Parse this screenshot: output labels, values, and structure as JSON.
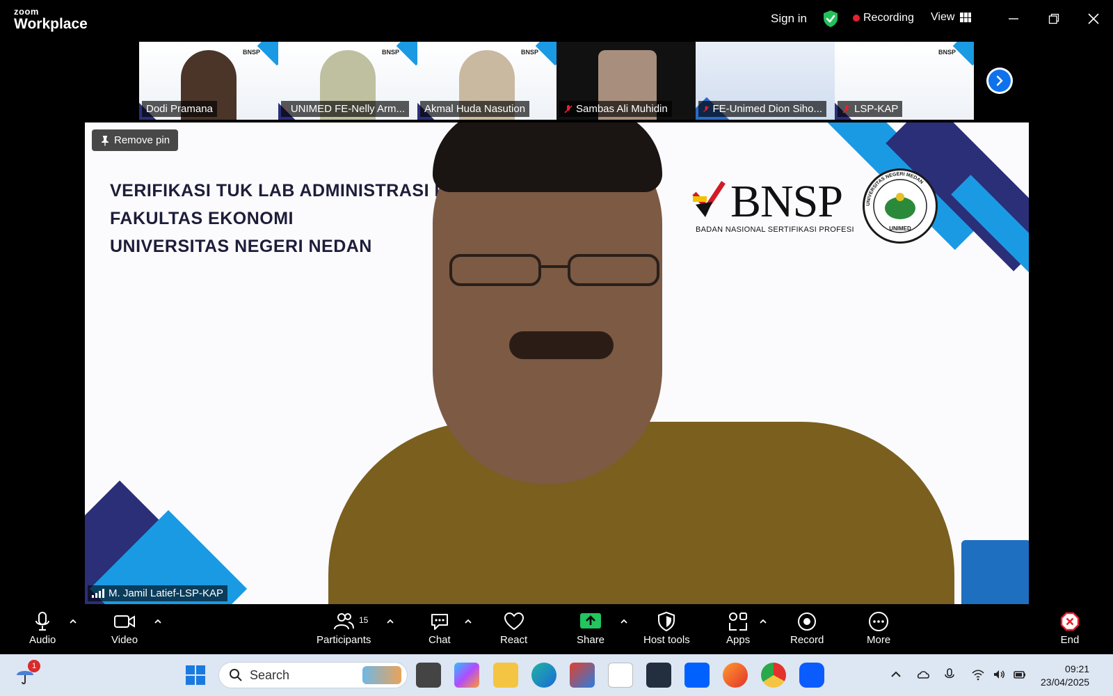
{
  "app": {
    "brand_small": "zoom",
    "brand_big": "Workplace"
  },
  "titlebar": {
    "sign_in": "Sign in",
    "recording": "Recording",
    "view": "View"
  },
  "participants_strip": [
    {
      "name": "Dodi Pramana",
      "muted": false
    },
    {
      "name": "UNIMED FE-Nelly Arm...",
      "muted": true
    },
    {
      "name": "Akmal Huda Nasution",
      "muted": false
    },
    {
      "name": "Sambas Ali Muhidin",
      "muted": true
    },
    {
      "name": "FE-Unimed Dion Siho...",
      "muted": true
    },
    {
      "name": "LSP-KAP",
      "muted": true
    }
  ],
  "main_video": {
    "remove_pin": "Remove pin",
    "slide_title_lines": [
      "VERIFIKASI TUK LAB ADMINISTRASI PE",
      "FAKULTAS EKONOMI",
      "UNIVERSITAS NEGERI NEDAN"
    ],
    "bnsp_word": "BNSP",
    "bnsp_sub": "BADAN NASIONAL SERTIFIKASI PROFESI",
    "unimed_ring": "UNIVERSITAS NEGERI MEDAN",
    "unimed_short": "UNIMED",
    "speaker_name": "M. Jamil Latief-LSP-KAP"
  },
  "toolbar": {
    "audio": "Audio",
    "video": "Video",
    "participants": "Participants",
    "participants_count": "15",
    "chat": "Chat",
    "react": "React",
    "share": "Share",
    "host_tools": "Host tools",
    "apps": "Apps",
    "record": "Record",
    "more": "More",
    "end": "End"
  },
  "taskbar": {
    "search_placeholder": "Search",
    "notification_count": "1",
    "time": "09:21",
    "date": "23/04/2025"
  },
  "colors": {
    "accent_blue": "#0e72ed",
    "recording_red": "#e8212f",
    "share_green": "#22c55e",
    "end_red": "#e8212f",
    "slide_navy": "#2b2f78",
    "slide_cyan": "#1b9ae4"
  }
}
